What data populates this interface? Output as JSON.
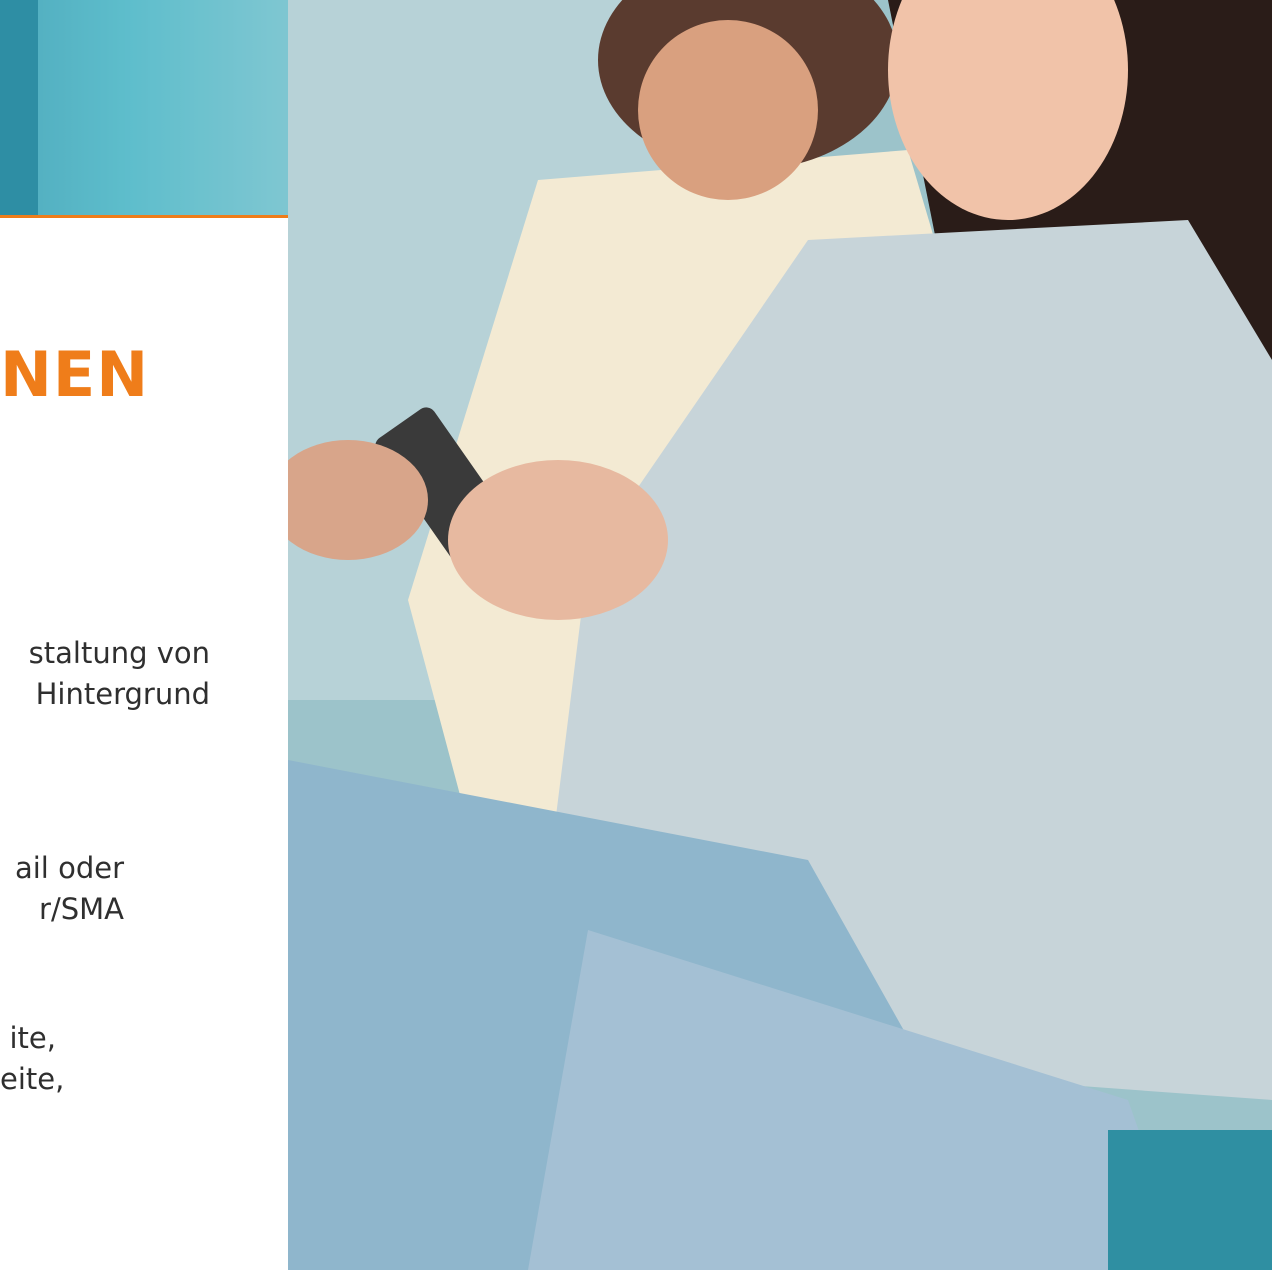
{
  "heading": "NEN",
  "paragraphs": [
    {
      "lines": [
        "staltung von",
        "Hintergrund"
      ]
    },
    {
      "lines": [
        "ail oder",
        "r/SMA"
      ]
    },
    {
      "lines": [
        "ite,",
        "eite,"
      ]
    }
  ],
  "colors": {
    "accent": "#ef7d1a",
    "text": "#2f2f2f"
  }
}
